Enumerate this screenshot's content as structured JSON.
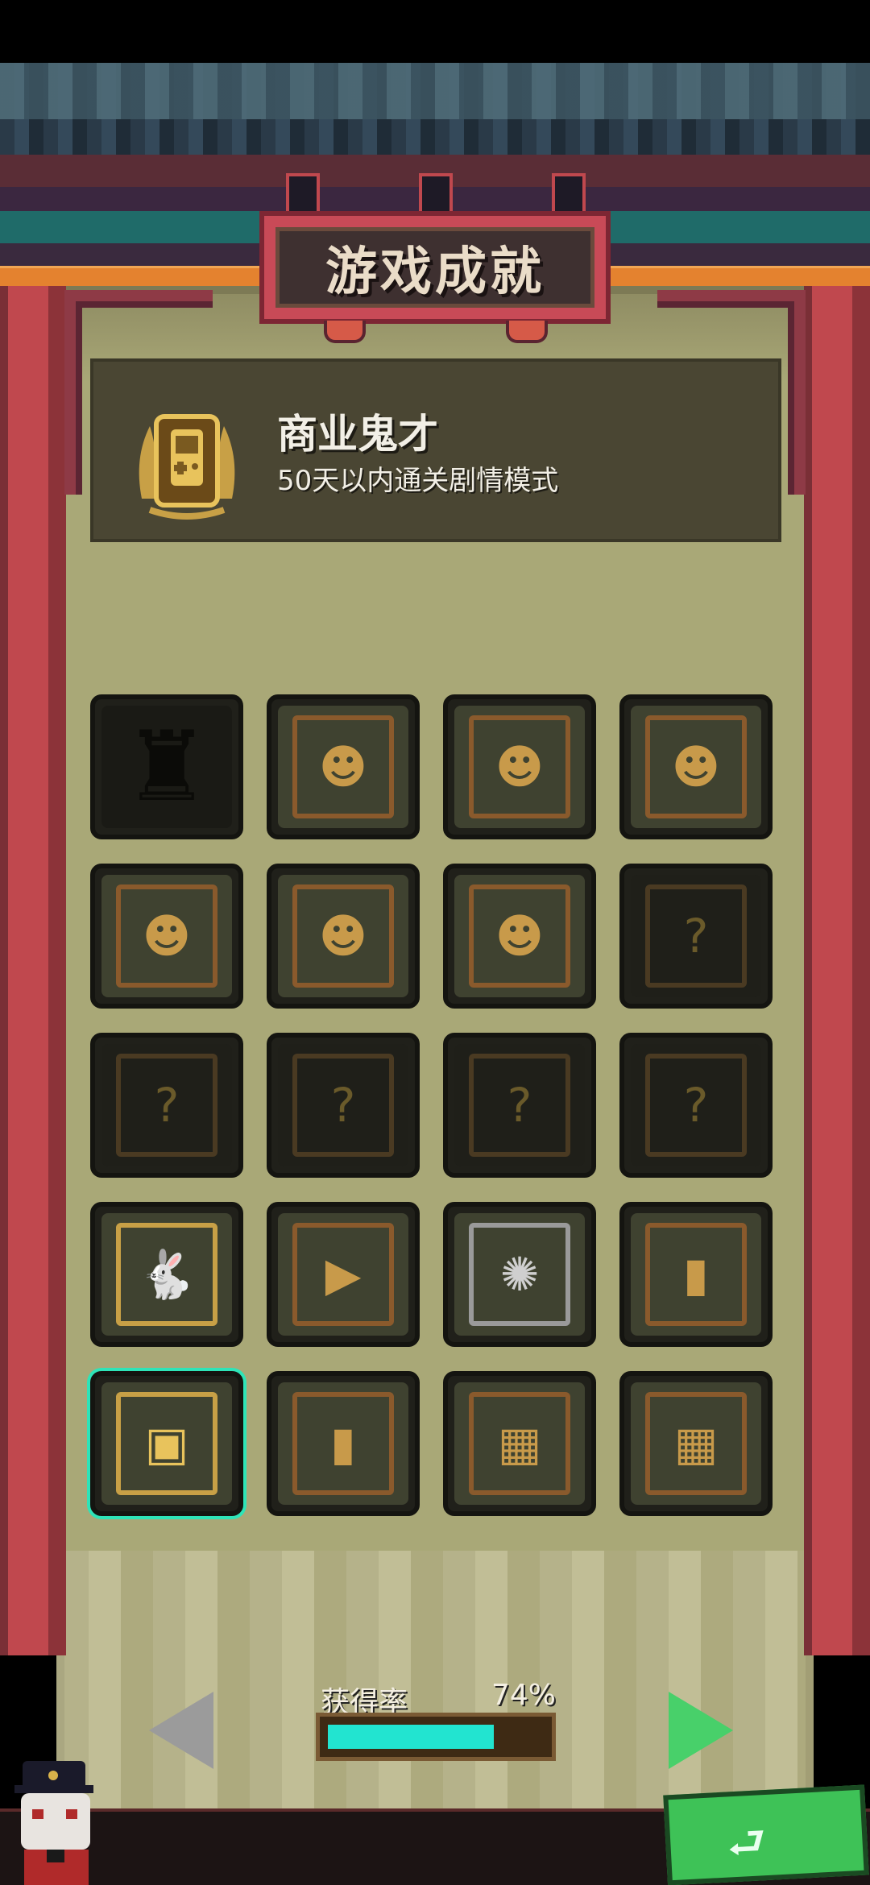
{
  "title": "游戏成就",
  "selected_achievement": {
    "name": "商业鬼才",
    "description": "50天以内通关剧情模式",
    "icon": "gameboy-badge-icon"
  },
  "achievements": [
    {
      "id": "silhouette-locked",
      "icon": "locked-silhouette-icon",
      "state": "locked"
    },
    {
      "id": "portrait-old-man",
      "icon": "portrait-icon",
      "state": "bronze"
    },
    {
      "id": "portrait-young-man",
      "icon": "portrait-icon",
      "state": "bronze"
    },
    {
      "id": "portrait-hat-man",
      "icon": "portrait-icon",
      "state": "bronze"
    },
    {
      "id": "portrait-sunglasses-man",
      "icon": "portrait-icon",
      "state": "bronze"
    },
    {
      "id": "portrait-mustache-man",
      "icon": "portrait-icon",
      "state": "bronze"
    },
    {
      "id": "portrait-woman",
      "icon": "portrait-icon",
      "state": "bronze"
    },
    {
      "id": "question-dark-1",
      "icon": "question-icon",
      "state": "dim"
    },
    {
      "id": "question-dark-2",
      "icon": "question-icon",
      "state": "dim"
    },
    {
      "id": "question-dark-3",
      "icon": "question-icon",
      "state": "dim"
    },
    {
      "id": "question-dark-4",
      "icon": "question-icon",
      "state": "dim"
    },
    {
      "id": "question-dark-5",
      "icon": "question-icon",
      "state": "dim"
    },
    {
      "id": "rabbit-gold",
      "icon": "rabbit-icon",
      "state": "gold"
    },
    {
      "id": "play-bronze",
      "icon": "play-icon",
      "state": "bronze"
    },
    {
      "id": "octopus-silver",
      "icon": "octopus-icon",
      "state": "silver"
    },
    {
      "id": "card-bronze",
      "icon": "card-icon",
      "state": "bronze"
    },
    {
      "id": "gameboy-gold",
      "icon": "gameboy-icon",
      "state": "gold",
      "selected": true
    },
    {
      "id": "card-bronze-2",
      "icon": "card-icon",
      "state": "bronze"
    },
    {
      "id": "map-bronze-1",
      "icon": "map-icon",
      "state": "bronze"
    },
    {
      "id": "map-bronze-2",
      "icon": "map-icon",
      "state": "bronze"
    }
  ],
  "rate": {
    "label": "获得率",
    "value_text": "74%",
    "fraction": 0.74
  },
  "colors": {
    "accent": "#22e4d0",
    "selection": "#2ee4b8",
    "next_arrow": "#48d06a",
    "prev_arrow": "#9b9b9b",
    "pillar_red": "#c0484e",
    "panel": "#a9a877"
  },
  "icons": {
    "prev": "arrow-left-icon",
    "next": "arrow-right-icon",
    "back": "return-arrow-icon"
  }
}
